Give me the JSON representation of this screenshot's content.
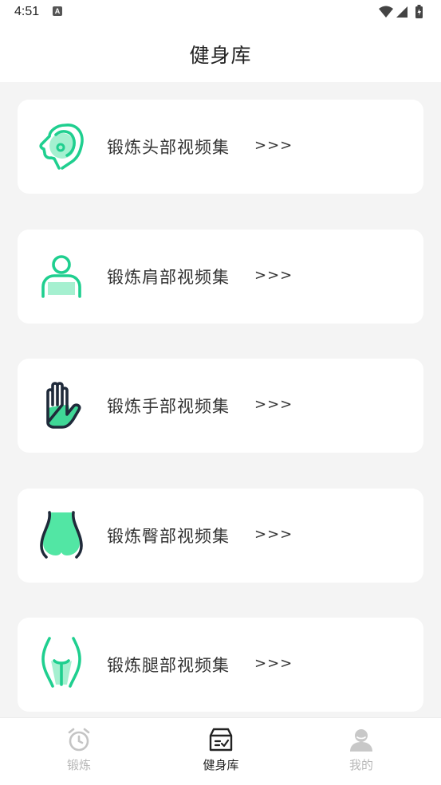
{
  "status_bar": {
    "time": "4:51",
    "notification_badge": "A",
    "icons": [
      "wifi-icon",
      "signal-icon",
      "battery-icon"
    ]
  },
  "header": {
    "title": "健身库"
  },
  "cards": [
    {
      "label": "锻炼头部视频集",
      "arrow": ">>>",
      "icon": "head-icon"
    },
    {
      "label": "锻炼肩部视频集",
      "arrow": ">>>",
      "icon": "shoulder-icon"
    },
    {
      "label": "锻炼手部视频集",
      "arrow": ">>>",
      "icon": "hand-icon"
    },
    {
      "label": "锻炼臀部视频集",
      "arrow": ">>>",
      "icon": "hip-icon"
    },
    {
      "label": "锻炼腿部视频集",
      "arrow": ">>>",
      "icon": "leg-icon"
    }
  ],
  "bottom_nav": {
    "items": [
      {
        "label": "锻炼",
        "icon": "alarm-clock-icon",
        "active": false
      },
      {
        "label": "健身库",
        "icon": "library-box-icon",
        "active": true
      },
      {
        "label": "我的",
        "icon": "user-icon",
        "active": false
      }
    ]
  },
  "colors": {
    "accent": "#1fcf8f",
    "accent_light": "#a5f0d0",
    "dark_outline": "#1f2a3a",
    "background": "#f4f4f4",
    "card": "#ffffff"
  }
}
